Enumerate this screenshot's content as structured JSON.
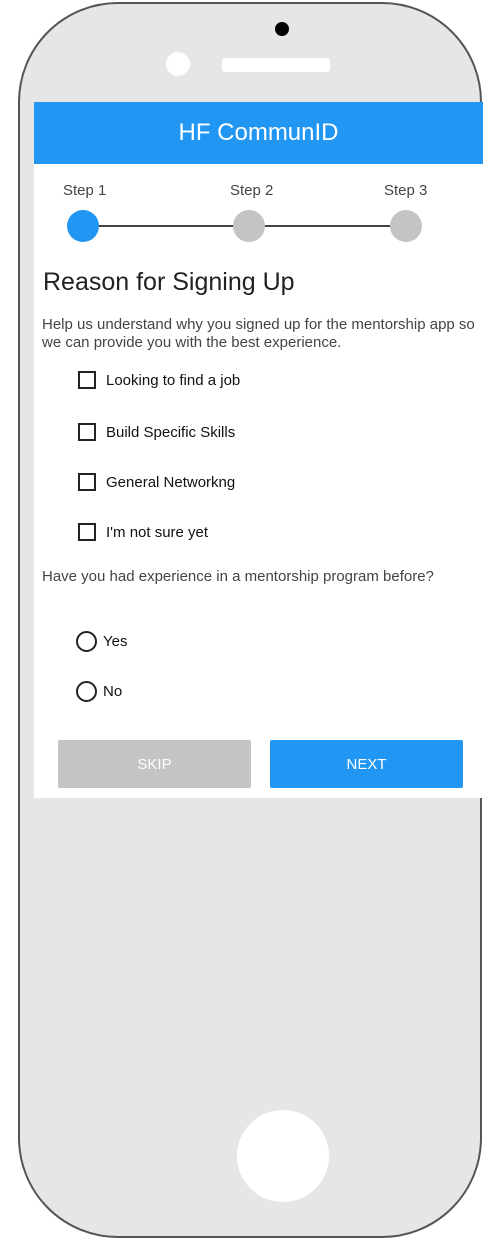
{
  "app": {
    "title": "HF CommunID"
  },
  "stepper": {
    "steps": [
      {
        "label": "Step 1",
        "active": true
      },
      {
        "label": "Step 2",
        "active": false
      },
      {
        "label": "Step 3",
        "active": false
      }
    ]
  },
  "reason": {
    "heading": "Reason for Signing Up",
    "description": "Help us understand why you signed up for the mentorship app so we can provide you with the best experience.",
    "options": [
      {
        "label": "Looking to find a job",
        "checked": false
      },
      {
        "label": "Build Specific Skills",
        "checked": false
      },
      {
        "label": "General Networkng",
        "checked": false
      },
      {
        "label": "I'm not sure yet",
        "checked": false
      }
    ]
  },
  "experience": {
    "question": "Have you had experience in a mentorship program before?",
    "options": [
      {
        "label": "Yes",
        "selected": false
      },
      {
        "label": "No",
        "selected": false
      }
    ]
  },
  "actions": {
    "skip_label": "SKIP",
    "next_label": "NEXT"
  },
  "colors": {
    "accent": "#2196f3",
    "inactive": "#c4c4c4",
    "device": "#e6e6e6"
  }
}
